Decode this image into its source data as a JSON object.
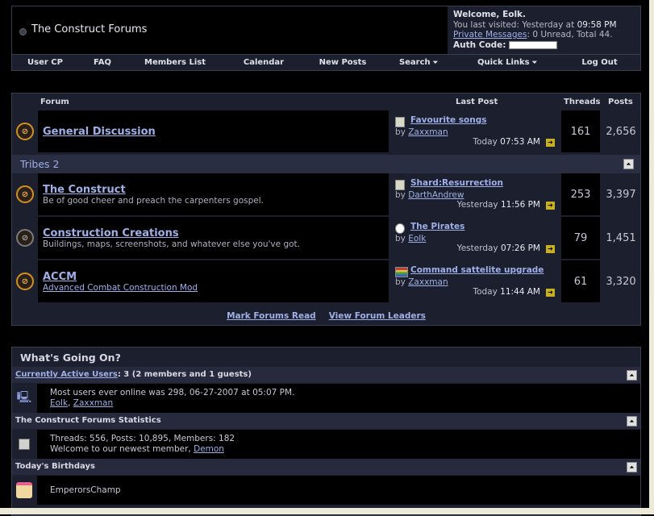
{
  "header": {
    "site_title": "The Construct Forums",
    "welcome_title": "Welcome, Eolk.",
    "last_visited_prefix": "You last visited: Yesterday at ",
    "last_visited_time": "09:58 PM",
    "pm_link": "Private Messages",
    "pm_status": ": 0 Unread, Total 44.",
    "auth_label": "Auth Code:"
  },
  "navbar": {
    "items": [
      "User CP",
      "FAQ",
      "Members List",
      "Calendar",
      "New Posts",
      "Search",
      "Quick Links",
      "Log Out"
    ],
    "arrow": "⏷"
  },
  "forum_table": {
    "headers": {
      "forum": "Forum",
      "last_post": "Last Post",
      "threads": "Threads",
      "posts": "Posts"
    },
    "top_forum": {
      "title": "General Discussion",
      "last_post_title": "Favourite songs",
      "by": "by",
      "last_post_user": "Zaxxman",
      "last_post_day": "Today",
      "last_post_time": "07:53 AM",
      "threads": "161",
      "posts": "2,656"
    },
    "category": "Tribes 2",
    "forums": [
      {
        "title": "The Construct",
        "description": "Be of good cheer and preach the carpenters gospel.",
        "last_post_title": "Shard:Resurrection",
        "last_post_user": "DarthAndrew",
        "last_post_day": "Yesterday",
        "last_post_time": "11:56 PM",
        "threads": "253",
        "posts": "3,397"
      },
      {
        "title": "Construction Creations",
        "description": "Buildings, maps, screenshots, and whatever else you've got.",
        "last_post_title": "The Pirates",
        "last_post_user": "Eolk",
        "last_post_day": "Yesterday",
        "last_post_time": "07:26 PM",
        "threads": "79",
        "posts": "1,451"
      },
      {
        "title": "ACCM",
        "description": "Advanced Combat Construction Mod",
        "last_post_title": "Command sattelite upgrade",
        "last_post_user": "Zaxxman",
        "last_post_day": "Today",
        "last_post_time": "11:44 AM",
        "threads": "61",
        "posts": "3,320"
      }
    ],
    "footer_links": [
      "Mark Forums Read",
      "View Forum Leaders"
    ]
  },
  "whats_going_on": {
    "title": "What's Going On?",
    "active_users_link": "Currently Active Users",
    "active_users_count": ": 3 (2 members and 1 guests)",
    "most_online": "Most users ever online was 298, 06-27-2007 at 05:07 PM.",
    "online_users": [
      "Eolk",
      "Zaxxman"
    ],
    "stats_title": "The Construct Forums Statistics",
    "stats_line": "Threads: 556, Posts: 10,895, Members: 182",
    "newest_prefix": "Welcome to our newest member, ",
    "newest_member": "Demon",
    "birthdays_title": "Today's Birthdays",
    "birthday_user": "EmperorsChamp"
  }
}
